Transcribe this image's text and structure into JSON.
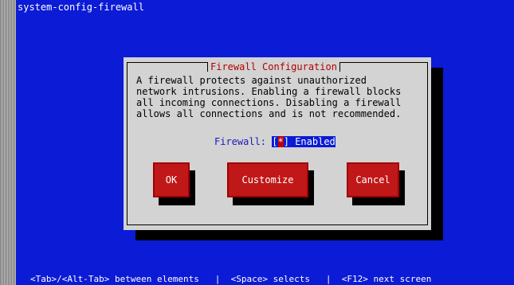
{
  "terminal": {
    "title": "system-config-firewall"
  },
  "dialog": {
    "title": "Firewall Configuration",
    "message_lines": [
      "A firewall protects against unauthorized",
      "network intrusions. Enabling a firewall blocks",
      "all incoming connections. Disabling a firewall",
      "allows all connections and is not recommended."
    ],
    "firewall_label": "Firewall:",
    "checkbox_open": "[",
    "checkbox_mark": "*",
    "checkbox_close": "]",
    "firewall_value": "Enabled"
  },
  "buttons": {
    "ok": "OK",
    "customize": "Customize",
    "cancel": "Cancel"
  },
  "footer": {
    "help": "<Tab>/<Alt-Tab> between elements   |  <Space> selects   |  <F12> next screen"
  },
  "colors": {
    "terminal_bg": "#0b1bd6",
    "dialog_bg": "#d3d3d3",
    "button_bg": "#c01818",
    "title_text": "#b00000"
  }
}
